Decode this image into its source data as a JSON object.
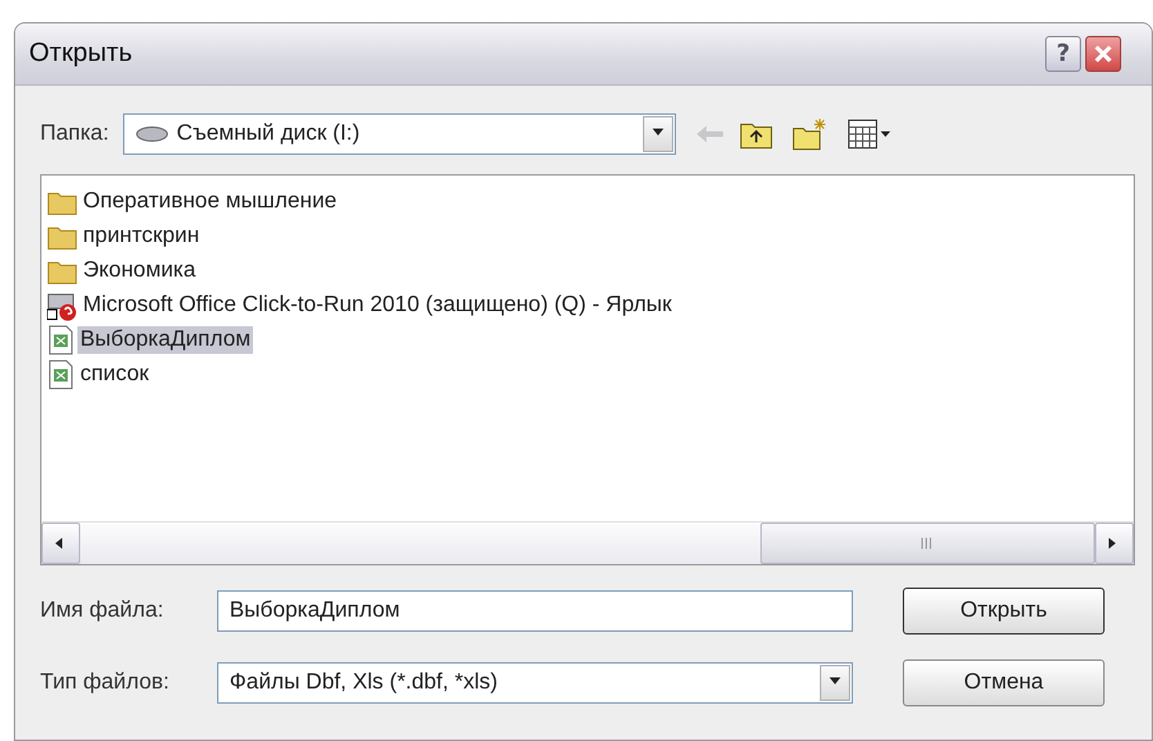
{
  "window": {
    "title": "Открыть",
    "help_button": "?"
  },
  "look_in": {
    "label": "Папка:",
    "value": "Съемный диск (I:)"
  },
  "files": [
    {
      "name": "Оперативное мышление",
      "kind": "folder",
      "selected": false
    },
    {
      "name": "принтскрин",
      "kind": "folder",
      "selected": false
    },
    {
      "name": "Экономика",
      "kind": "folder",
      "selected": false
    },
    {
      "name": "Microsoft Office Click-to-Run 2010 (защищено) (Q) - Ярлык",
      "kind": "shortcut",
      "selected": false
    },
    {
      "name": "ВыборкаДиплом",
      "kind": "spreadsheet",
      "selected": true
    },
    {
      "name": "список",
      "kind": "spreadsheet",
      "selected": false
    }
  ],
  "file_name": {
    "label": "Имя файла:",
    "value": "ВыборкаДиплом"
  },
  "file_type": {
    "label": "Тип файлов:",
    "value": "Файлы Dbf, Xls (*.dbf, *xls)"
  },
  "buttons": [
    "Открыть",
    "Отмена"
  ]
}
